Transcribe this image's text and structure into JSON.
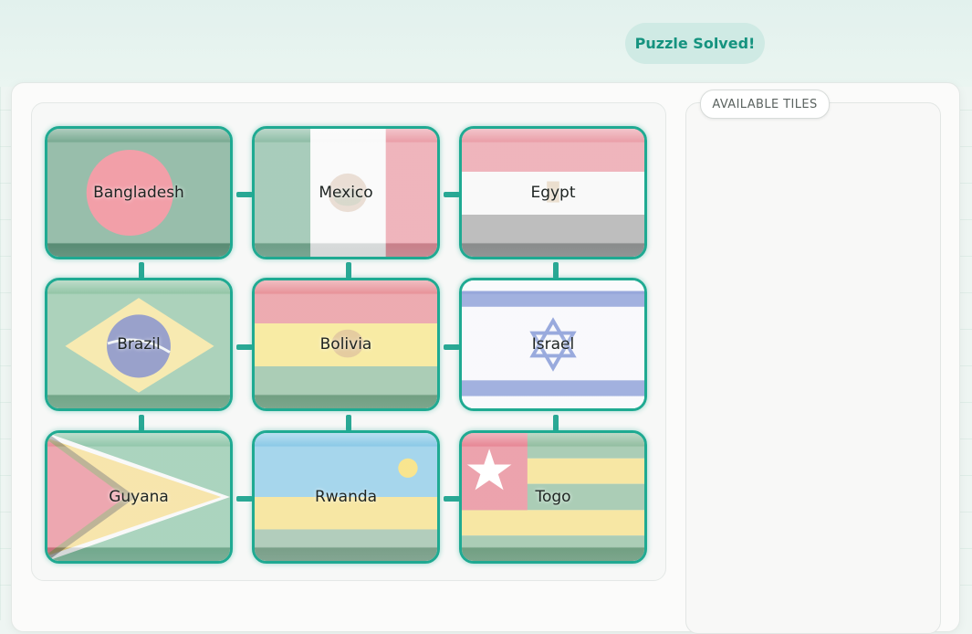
{
  "status": {
    "text": "Puzzle Solved!"
  },
  "tray": {
    "label": "AVAILABLE TILES"
  },
  "grid": {
    "rows": 3,
    "cols": 3,
    "tiles": [
      {
        "name": "Bangladesh",
        "flag": "bangladesh"
      },
      {
        "name": "Mexico",
        "flag": "mexico"
      },
      {
        "name": "Egypt",
        "flag": "egypt"
      },
      {
        "name": "Brazil",
        "flag": "brazil"
      },
      {
        "name": "Bolivia",
        "flag": "bolivia"
      },
      {
        "name": "Israel",
        "flag": "israel"
      },
      {
        "name": "Guyana",
        "flag": "guyana"
      },
      {
        "name": "Rwanda",
        "flag": "rwanda"
      },
      {
        "name": "Togo",
        "flag": "togo"
      }
    ]
  },
  "colors": {
    "accent": "#1faa92",
    "status_bg": "#cfeae4",
    "status_text": "#15937f"
  }
}
